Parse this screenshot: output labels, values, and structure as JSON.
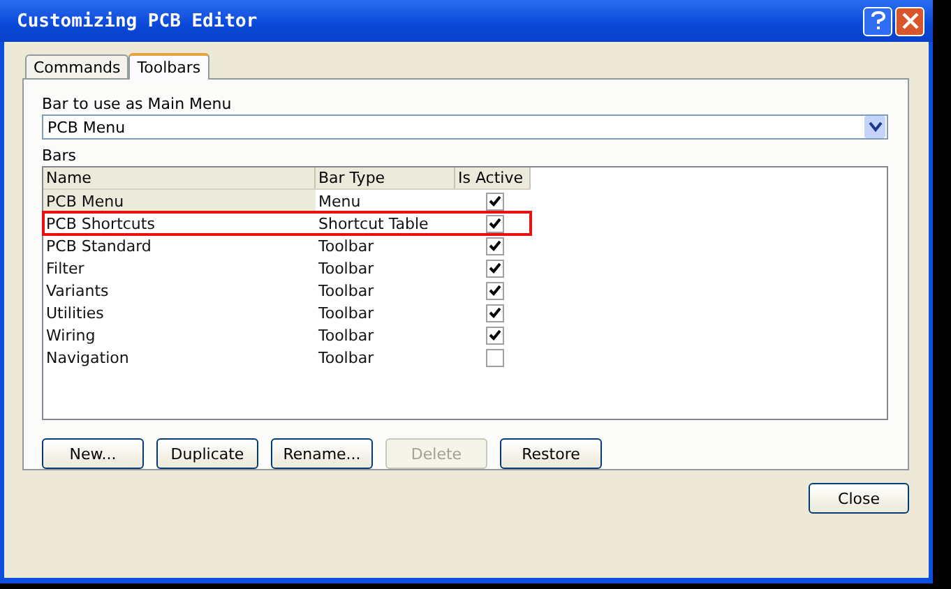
{
  "window": {
    "title": "Customizing PCB Editor"
  },
  "tabs": [
    {
      "label": "Commands",
      "selected": false
    },
    {
      "label": "Toolbars",
      "selected": true
    }
  ],
  "main_menu": {
    "label": "Bar to use as Main Menu",
    "value": "PCB Menu"
  },
  "bars": {
    "label": "Bars",
    "columns": [
      "Name",
      "Bar Type",
      "Is Active"
    ],
    "rows": [
      {
        "name": "PCB Menu",
        "type": "Menu",
        "checked": true,
        "selected": true,
        "highlighted": false
      },
      {
        "name": "PCB Shortcuts",
        "type": "Shortcut Table",
        "checked": true,
        "selected": false,
        "highlighted": true
      },
      {
        "name": "PCB Standard",
        "type": "Toolbar",
        "checked": true,
        "selected": false,
        "highlighted": false
      },
      {
        "name": "Filter",
        "type": "Toolbar",
        "checked": true,
        "selected": false,
        "highlighted": false
      },
      {
        "name": "Variants",
        "type": "Toolbar",
        "checked": true,
        "selected": false,
        "highlighted": false
      },
      {
        "name": "Utilities",
        "type": "Toolbar",
        "checked": true,
        "selected": false,
        "highlighted": false
      },
      {
        "name": "Wiring",
        "type": "Toolbar",
        "checked": true,
        "selected": false,
        "highlighted": false
      },
      {
        "name": "Navigation",
        "type": "Toolbar",
        "checked": false,
        "selected": false,
        "highlighted": false
      }
    ]
  },
  "buttons": [
    {
      "label": "New...",
      "disabled": false
    },
    {
      "label": "Duplicate",
      "disabled": false
    },
    {
      "label": "Rename...",
      "disabled": false
    },
    {
      "label": "Delete",
      "disabled": true
    },
    {
      "label": "Restore",
      "disabled": false
    }
  ],
  "close_button": "Close"
}
